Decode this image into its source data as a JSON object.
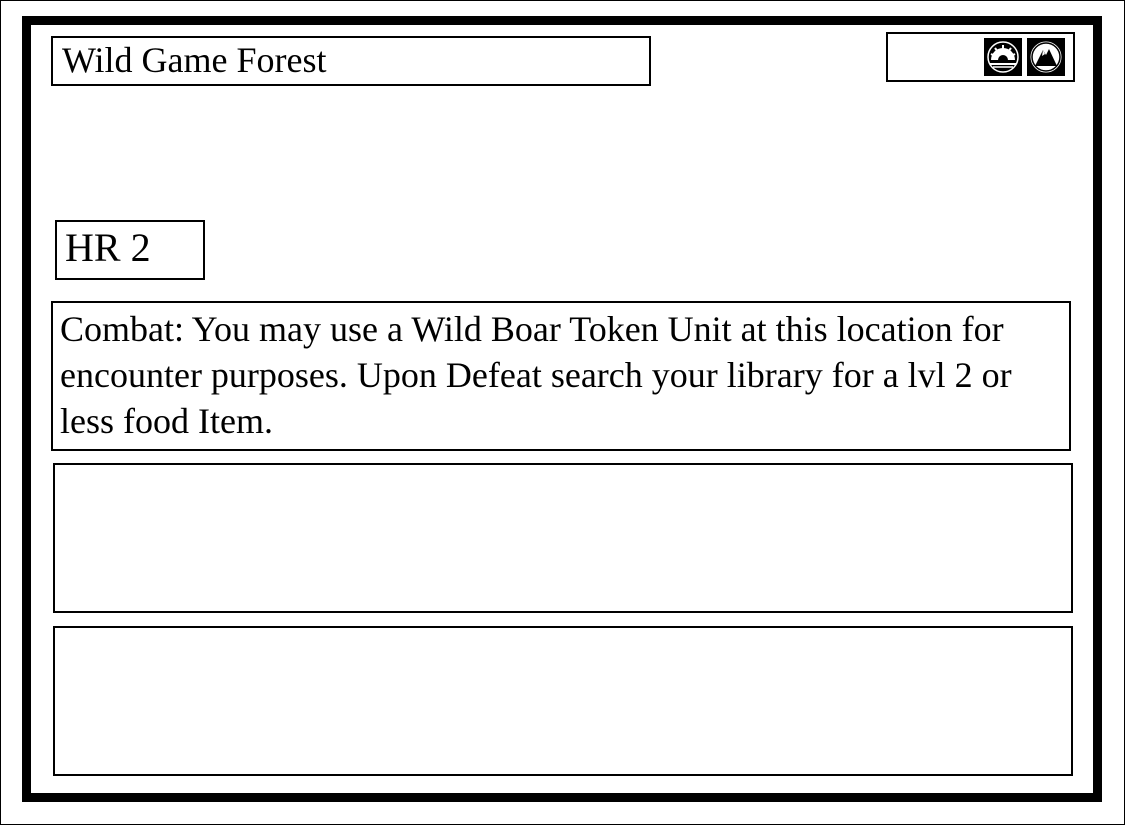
{
  "card": {
    "title": "Wild Game Forest",
    "hr_label": "HR 2",
    "ability_text": "Combat: You may use a Wild Boar Token Unit at this location for encounter purposes. Upon Defeat search your library for a lvl 2 or less food Item.",
    "icons": [
      "sun-icon",
      "mountain-icon"
    ],
    "empty_panels": [
      "",
      ""
    ]
  }
}
